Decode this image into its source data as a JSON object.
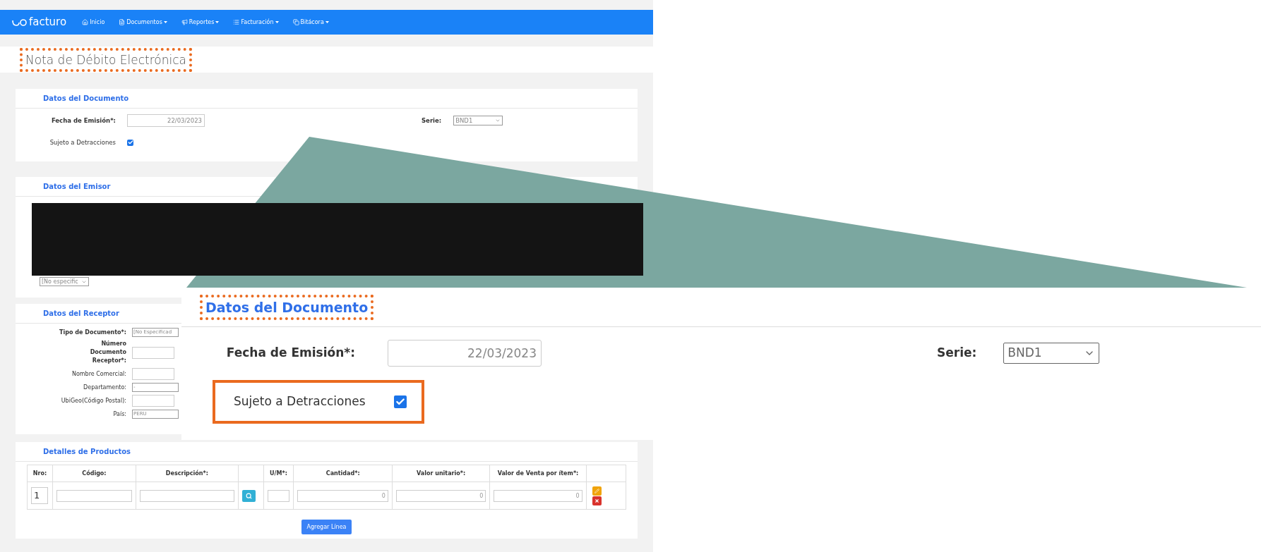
{
  "navbar": {
    "logo_text": "facturo",
    "items": [
      {
        "label": "Inicio",
        "dropdown": false
      },
      {
        "label": "Documentos",
        "dropdown": true
      },
      {
        "label": "Reportes",
        "dropdown": true
      },
      {
        "label": "Facturación",
        "dropdown": true
      },
      {
        "label": "Bitácora",
        "dropdown": true
      }
    ]
  },
  "page_title": {
    "text": "Nota de Débito Electrónica",
    "highlighted": true
  },
  "documento": {
    "title": "Datos del Documento",
    "fecha_label": "Fecha de Emisión*:",
    "fecha_value": "22/03/2023",
    "serie_label": "Serie:",
    "serie_value": "BND1",
    "detracciones_label": "Sujeto a Detracciones",
    "detracciones_checked": true
  },
  "emisor": {
    "title": "Datos del Emisor",
    "select_value": "[No especific"
  },
  "receptor": {
    "title": "Datos del Receptor",
    "fields": [
      {
        "label": "Tipo de Documento*:",
        "kind": "select",
        "value": "[No Especificad"
      },
      {
        "label": "Número Documento Receptor*:",
        "kind": "input"
      },
      {
        "label": "Nombre Comercial:",
        "kind": "input"
      },
      {
        "label": "Departamento:",
        "kind": "select",
        "value": "-"
      },
      {
        "label": "UbiGeo(Código Postal):",
        "kind": "input"
      },
      {
        "label": "País:",
        "kind": "select",
        "value": "PERU"
      }
    ]
  },
  "productos": {
    "title": "Detalles de Productos",
    "columns": [
      "Nro:",
      "Código:",
      "Descripción*:",
      "",
      "U/M*:",
      "Cantidad*:",
      "Valor unitario*:",
      "Valor de Venta por ítem*:",
      ""
    ],
    "rows": [
      {
        "nro": "1",
        "cantidad": "0",
        "valor_unitario": "0",
        "valor_venta": "0"
      }
    ],
    "add_button": "Agregar Línea"
  },
  "zoom_inset": {
    "title": "Datos del Documento",
    "title_highlighted": true,
    "fecha_label": "Fecha de Emisión*:",
    "fecha_value": "22/03/2023",
    "serie_label": "Serie:",
    "serie_value": "BND1",
    "detracciones_label": "Sujeto a Detracciones",
    "detracciones_checked": true,
    "detracciones_highlighted": true
  }
}
